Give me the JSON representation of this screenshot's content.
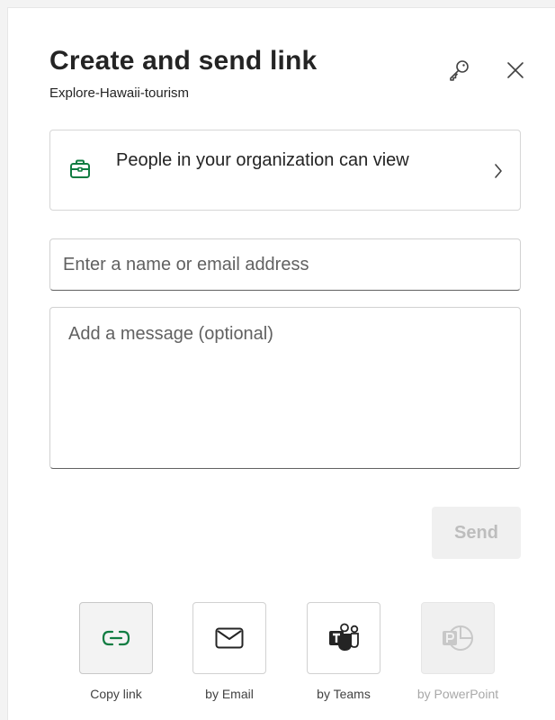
{
  "dialog": {
    "title": "Create and send link",
    "subtitle": "Explore-Hawaii-tourism",
    "header_icons": [
      "key-icon",
      "close-icon"
    ]
  },
  "permission": {
    "text": "People in your organization can view",
    "icon": "briefcase-icon",
    "icon_color": "#107c41"
  },
  "recipient": {
    "placeholder": "Enter a name or email address",
    "value": ""
  },
  "message": {
    "placeholder": "Add a message (optional)",
    "value": ""
  },
  "send": {
    "label": "Send",
    "enabled": false
  },
  "share_options": [
    {
      "label": "Copy link",
      "icon": "link-icon",
      "selected": true,
      "enabled": true
    },
    {
      "label": "by Email",
      "icon": "mail-icon",
      "selected": false,
      "enabled": true
    },
    {
      "label": "by Teams",
      "icon": "teams-icon",
      "selected": false,
      "enabled": true
    },
    {
      "label": "by PowerPoint",
      "icon": "powerpoint-icon",
      "selected": false,
      "enabled": false
    }
  ],
  "colors": {
    "accent_green": "#107c41",
    "teams_dark": "#242424",
    "disabled_text": "#bdbdbd"
  }
}
